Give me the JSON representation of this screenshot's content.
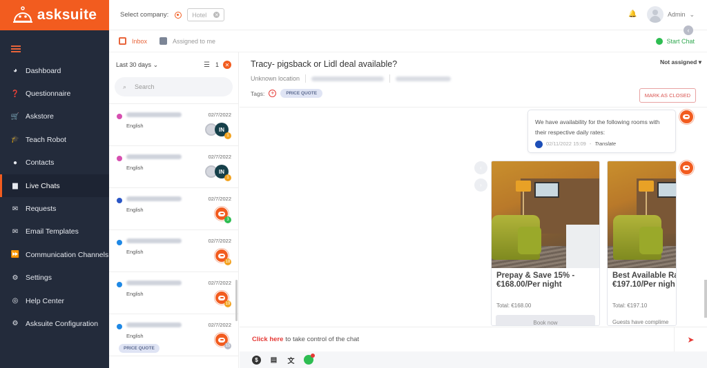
{
  "app": {
    "brand": "asksuite"
  },
  "topbar": {
    "select_company_label": "Select company:",
    "company_value": "Hotel",
    "user_name": "Admin"
  },
  "subbar": {
    "tabs": [
      {
        "label": "Inbox",
        "active": true
      },
      {
        "label": "Assigned to me",
        "active": false
      }
    ],
    "start_chat": "Start Chat"
  },
  "sidebar": {
    "items": [
      {
        "label": "Dashboard",
        "icon": "dashboard-icon"
      },
      {
        "label": "Questionnaire",
        "icon": "question-icon"
      },
      {
        "label": "Askstore",
        "icon": "cart-icon"
      },
      {
        "label": "Teach Robot",
        "icon": "graduation-cap-icon"
      },
      {
        "label": "Contacts",
        "icon": "contact-icon"
      },
      {
        "label": "Live Chats",
        "icon": "chat-icon",
        "active": true
      },
      {
        "label": "Requests",
        "icon": "envelope-open-icon"
      },
      {
        "label": "Email Templates",
        "icon": "envelope-icon"
      },
      {
        "label": "Communication Channels",
        "icon": "fast-forward-icon"
      },
      {
        "label": "Settings",
        "icon": "gear-icon"
      },
      {
        "label": "Help Center",
        "icon": "lifebuoy-icon"
      },
      {
        "label": "Asksuite Configuration",
        "icon": "gear-icon"
      }
    ]
  },
  "list": {
    "period": "Last 30 days",
    "filter_count": "1",
    "search_placeholder": "Search",
    "conversations": [
      {
        "language": "English",
        "date": "02/7/2022",
        "channel_color": "#d64fb0",
        "agent": "IN",
        "badge": "1",
        "badge_color": "#f2a21f"
      },
      {
        "language": "English",
        "date": "02/7/2022",
        "channel_color": "#d64fb0",
        "agent": "IN",
        "badge": "1",
        "badge_color": "#f2a21f"
      },
      {
        "language": "English",
        "date": "02/7/2022",
        "channel_color": "#2a56c6",
        "agent": "bot",
        "badge": "3",
        "badge_color": "#2ebd52"
      },
      {
        "language": "English",
        "date": "02/7/2022",
        "channel_color": "#1e88e5",
        "agent": "bot",
        "badge": "18",
        "badge_color": "#f2a21f"
      },
      {
        "language": "English",
        "date": "02/7/2022",
        "channel_color": "#1e88e5",
        "agent": "bot",
        "badge": "19",
        "badge_color": "#f2a21f"
      },
      {
        "language": "English",
        "date": "02/7/2022",
        "channel_color": "#1e88e5",
        "agent": "bot",
        "badge": "15",
        "badge_color": "#b9bcc8",
        "tag": "PRICE QUOTE"
      }
    ]
  },
  "chat": {
    "title": "Tracy- pigsback or Lidl deal available?",
    "location": "Unknown location",
    "tags_label": "Tags:",
    "tag": "PRICE QUOTE",
    "assignment": "Not assigned",
    "mark_closed": "MARK AS CLOSED",
    "message": {
      "text": "We have availability for the following rooms with their respective daily rates:",
      "timestamp": "02/11/2022 15:09",
      "separator": " - ",
      "translate": "Translate"
    },
    "cards": [
      {
        "title_line1": "Prepay & Save 15%  -",
        "title_line2": "€168.00/Per night",
        "total": "Total: €168.00",
        "button": "Book now"
      },
      {
        "title_line1": "Best Available Ra",
        "title_line2": "€197.10/Per nigh",
        "total": "Total: €197.10",
        "description": "Guests have complime"
      }
    ],
    "composer": {
      "link": "Click here",
      "text": "to take control of the chat"
    }
  }
}
